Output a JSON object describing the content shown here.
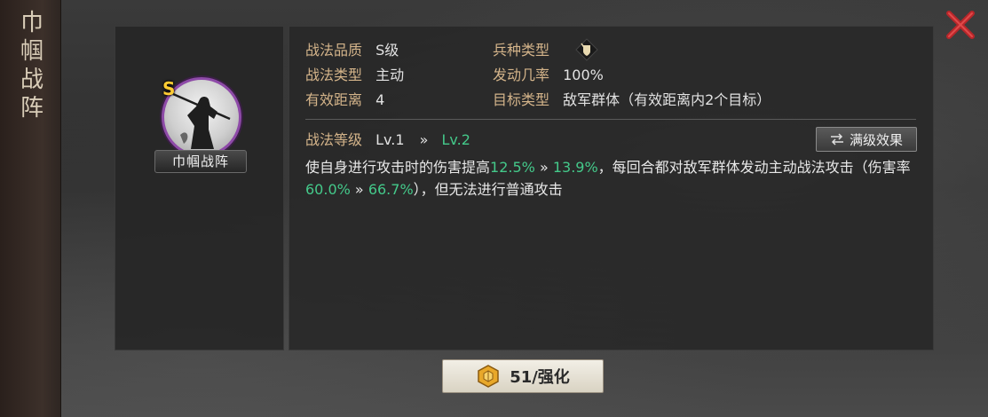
{
  "side_title": [
    "巾",
    "帼",
    "战",
    "阵"
  ],
  "tactic": {
    "grade_badge": "S",
    "name": "巾帼战阵"
  },
  "attributes": {
    "quality_label": "战法品质",
    "quality_value": "S级",
    "troop_type_label": "兵种类型",
    "troop_type_icon": "cavalry-shield-icon",
    "type_label": "战法类型",
    "type_value": "主动",
    "trigger_rate_label": "发动几率",
    "trigger_rate_value": "100%",
    "range_label": "有效距离",
    "range_value": "4",
    "target_label": "目标类型",
    "target_value": "敌军群体（有效距离内2个目标）"
  },
  "level": {
    "label": "战法等级",
    "current": "Lv.1",
    "arrow": "»",
    "next": "Lv.2",
    "max_button_label": "满级效果"
  },
  "description": {
    "part1": "使自身进行攻击时的伤害提高",
    "v1_from": "12.5%",
    "arrow1": "»",
    "v1_to": "13.9%",
    "part2": "，每回合都对敌军群体发动主动战法攻击（伤害率",
    "v2_from": "60.0%",
    "arrow2": "»",
    "v2_to": "66.7%",
    "part3": "），但无法进行普通攻击"
  },
  "enhance_button": {
    "label": "51/强化"
  },
  "colors": {
    "label": "#d4b48a",
    "highlight": "#44c98a",
    "close": "#b8262a",
    "portrait_ring": "#8e4aa8",
    "grade": "#ffcc33"
  }
}
